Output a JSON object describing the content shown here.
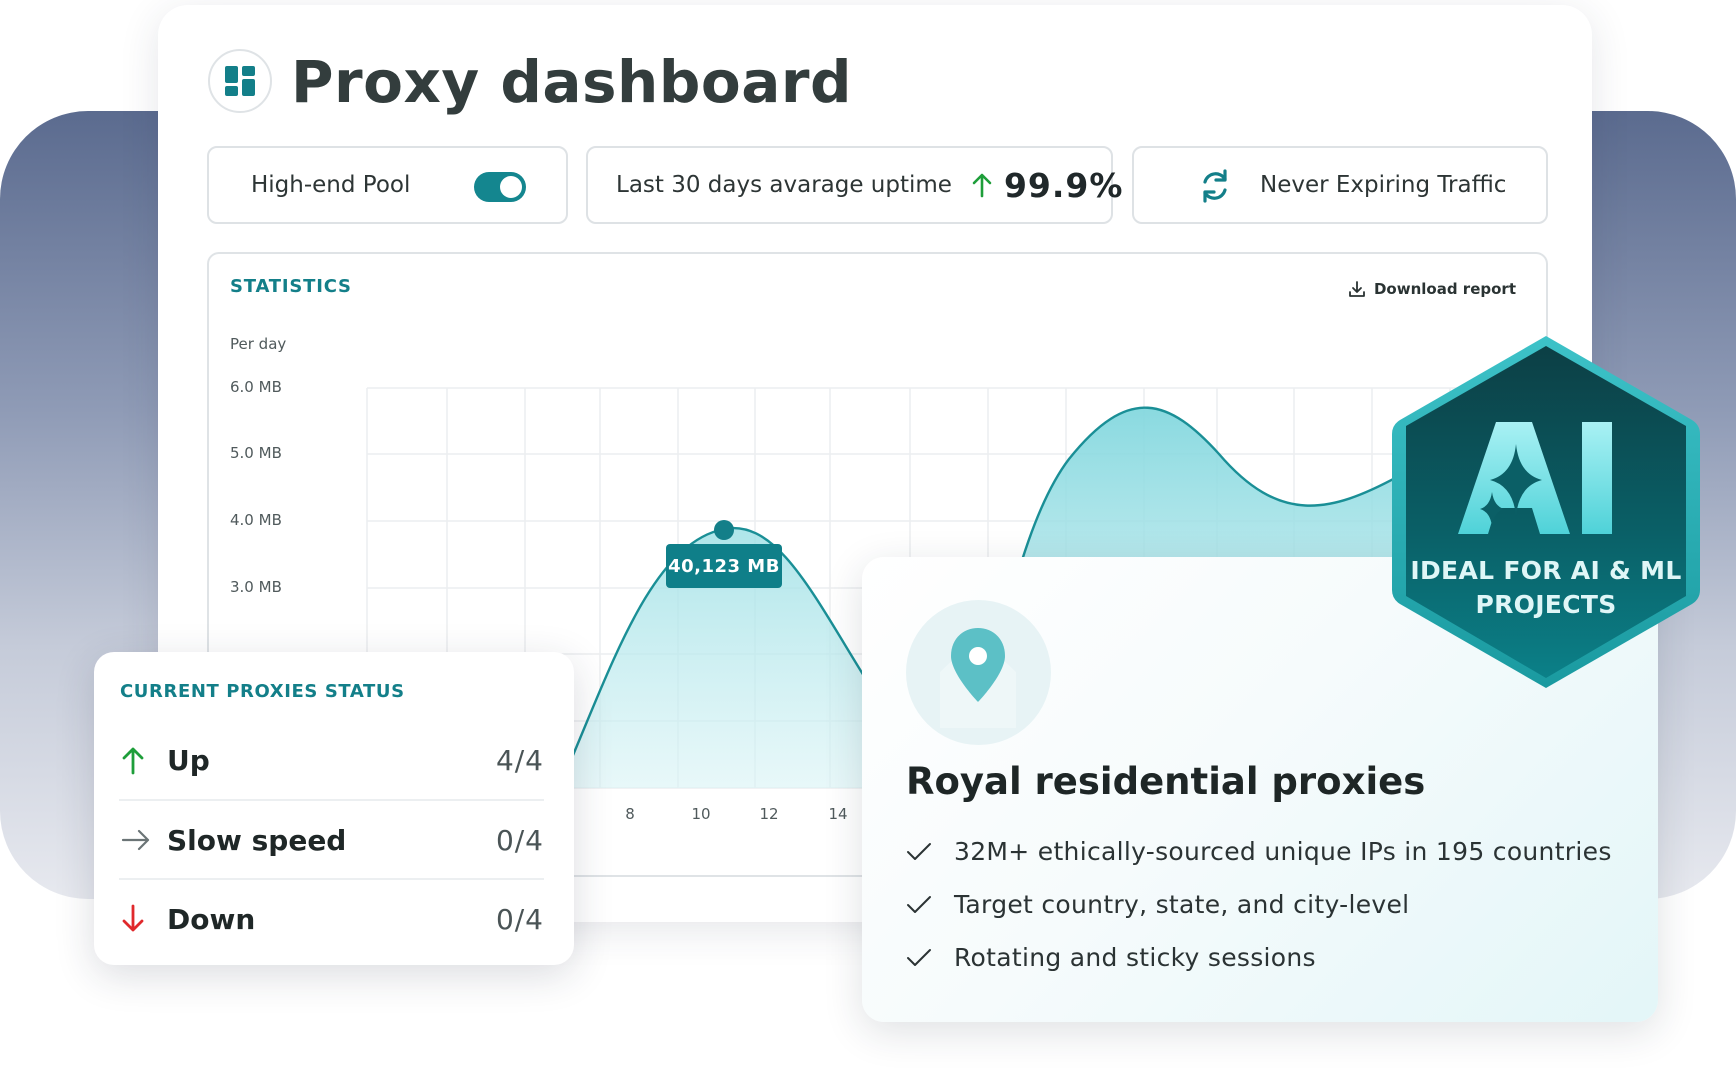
{
  "header": {
    "title": "Proxy dashboard",
    "icon": "dashboard-grid-icon"
  },
  "pills": {
    "pool_label": "High-end Pool",
    "pool_toggle_on": true,
    "uptime_label": "Last 30 days avarage uptime",
    "uptime_value": "99.9%",
    "traffic_label": "Never Expiring Traffic"
  },
  "statistics": {
    "title": "STATISTICS",
    "download_label": "Download report",
    "per_day_label": "Per day",
    "tooltip": "40,123 MB"
  },
  "chart_data": {
    "type": "area",
    "ylabel": "Per day",
    "yticks": [
      "6.0 MB",
      "5.0 MB",
      "4.0 MB",
      "3.0 MB"
    ],
    "xticks": [
      "8",
      "10",
      "12",
      "14"
    ],
    "highlight": {
      "label": "40,123 MB"
    },
    "color": "#1a8f96"
  },
  "proxies_status": {
    "title": "CURRENT PROXIES STATUS",
    "rows": [
      {
        "label": "Up",
        "count": "4/4",
        "icon": "arrow-up-icon",
        "color": "#1e9e3a"
      },
      {
        "label": "Slow speed",
        "count": "0/4",
        "icon": "arrow-right-icon",
        "color": "#6b7476"
      },
      {
        "label": "Down",
        "count": "0/4",
        "icon": "arrow-down-icon",
        "color": "#e0292c"
      }
    ]
  },
  "residential": {
    "title": "Royal residential proxies",
    "features": [
      "32M+ ethically-sourced unique IPs in 195 countries",
      "Target country, state, and city-level",
      "Rotating and sticky sessions"
    ]
  },
  "ai_badge": {
    "logo_text": "AI",
    "line1": "IDEAL FOR AI & ML",
    "line2": "PROJECTS"
  },
  "colors": {
    "accent": "#137f89",
    "toggle": "#14868f",
    "up_green": "#1e9e3a",
    "down_red": "#e0292c"
  }
}
